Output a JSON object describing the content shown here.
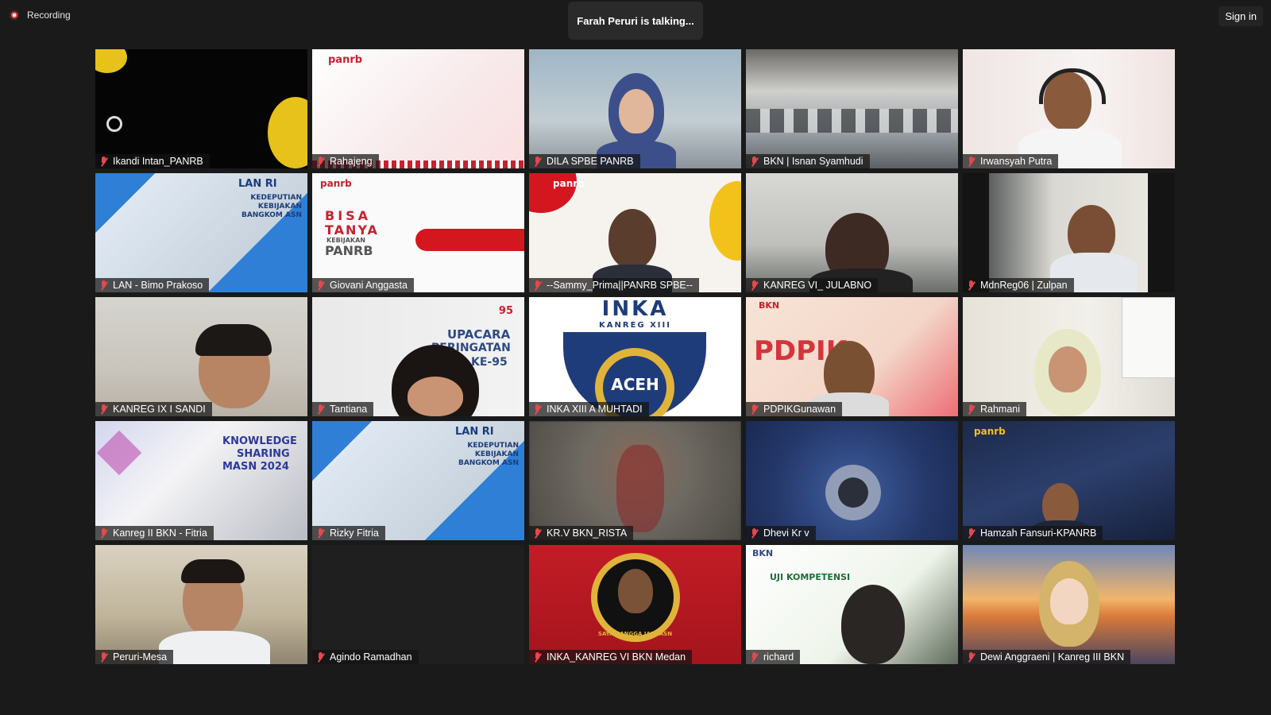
{
  "top": {
    "recording_label": "Recording",
    "talking_text": "Farah Peruri is talking...",
    "signin_label": "Sign in"
  },
  "participants": [
    {
      "name": "Ikandi Intan_PANRB"
    },
    {
      "name": "Rahajeng"
    },
    {
      "name": "DILA SPBE PANRB"
    },
    {
      "name": "BKN | Isnan Syamhudi"
    },
    {
      "name": "Irwansyah Putra"
    },
    {
      "name": "LAN - Bimo Prakoso"
    },
    {
      "name": "Giovani Anggasta"
    },
    {
      "name": "--Sammy_Prima||PANRB SPBE--"
    },
    {
      "name": "KANREG VI_ JULABNO"
    },
    {
      "name": "MdnReg06 | Zulpan"
    },
    {
      "name": "KANREG IX I SANDI"
    },
    {
      "name": "Tantiana"
    },
    {
      "name": "INKA XIII A MUHTADI"
    },
    {
      "name": "PDPIKGunawan"
    },
    {
      "name": "Rahmani"
    },
    {
      "name": "Kanreg II BKN - Fitria"
    },
    {
      "name": "Rizky Fitria"
    },
    {
      "name": "KR.V BKN_RISTA"
    },
    {
      "name": "Dhevi Kr v"
    },
    {
      "name": "Hamzah Fansuri-KPANRB"
    },
    {
      "name": "Peruri-Mesa"
    },
    {
      "name": "Agindo Ramadhan"
    },
    {
      "name": "INKA_KANREG VI BKN Medan"
    },
    {
      "name": "richard"
    },
    {
      "name": "Dewi Anggraeni | Kanreg III BKN"
    }
  ],
  "tile_text": {
    "panrb": "panrb",
    "lan_ri": "LAN RI",
    "kedeputian": "KEDEPUTIAN KEBIJAKAN BANGKOM ASN",
    "bisa": "BISA",
    "tanya": "TANYA",
    "kebijakan": "KEBIJAKAN",
    "panrb_caps": "PANRB",
    "upacara": "UPACARA",
    "peringatan": "PERINGATAN",
    "ke95": "KE-95",
    "inka": "INKA",
    "kanreg13": "KANREG XIII",
    "aceh": "ACEH",
    "pdpik": "PDPIK",
    "knowledge": "KNOWLEDGE",
    "sharing": "SHARING",
    "masn": "MASN 2024",
    "uji": "UJI KOMPETENSI",
    "bkn": "BKN",
    "bangga": "SAYA BANGGA JADI ASN",
    "num95": "95"
  },
  "colors": {
    "background": "#1a1a1a",
    "muted_mic": "#e5484d",
    "recording_dot": "#f04e4e",
    "panrb_red": "#c8202f",
    "lan_blue": "#2f7fd6",
    "inka_navy": "#1f3c7a",
    "inka_gold": "#e0b43a"
  }
}
